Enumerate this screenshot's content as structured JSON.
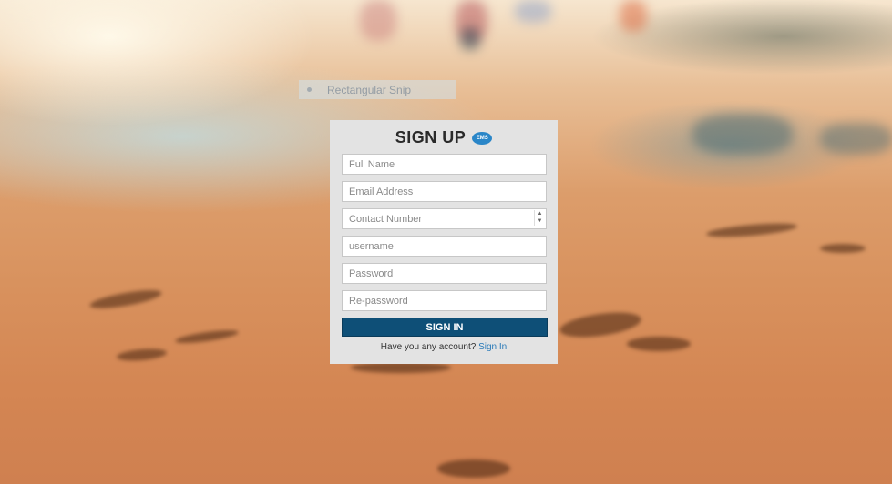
{
  "overlay": {
    "snip_label": "Rectangular Snip"
  },
  "form": {
    "title": "SIGN UP",
    "logo_text": "EMS",
    "logo_icon": "ems-logo-icon",
    "fields": {
      "full_name": {
        "placeholder": "Full Name",
        "value": ""
      },
      "email": {
        "placeholder": "Email Address",
        "value": ""
      },
      "contact": {
        "placeholder": "Contact Number",
        "value": ""
      },
      "username": {
        "placeholder": "username",
        "value": ""
      },
      "password": {
        "placeholder": "Password",
        "value": ""
      },
      "repassword": {
        "placeholder": "Re-password",
        "value": ""
      }
    },
    "submit_label": "SIGN IN",
    "footer_text": "Have you any account?",
    "footer_link": "Sign In"
  },
  "colors": {
    "card_bg": "#e3e3e3",
    "button_bg": "#0e4f77",
    "link": "#2a7ab8",
    "logo": "#2a86c8"
  }
}
